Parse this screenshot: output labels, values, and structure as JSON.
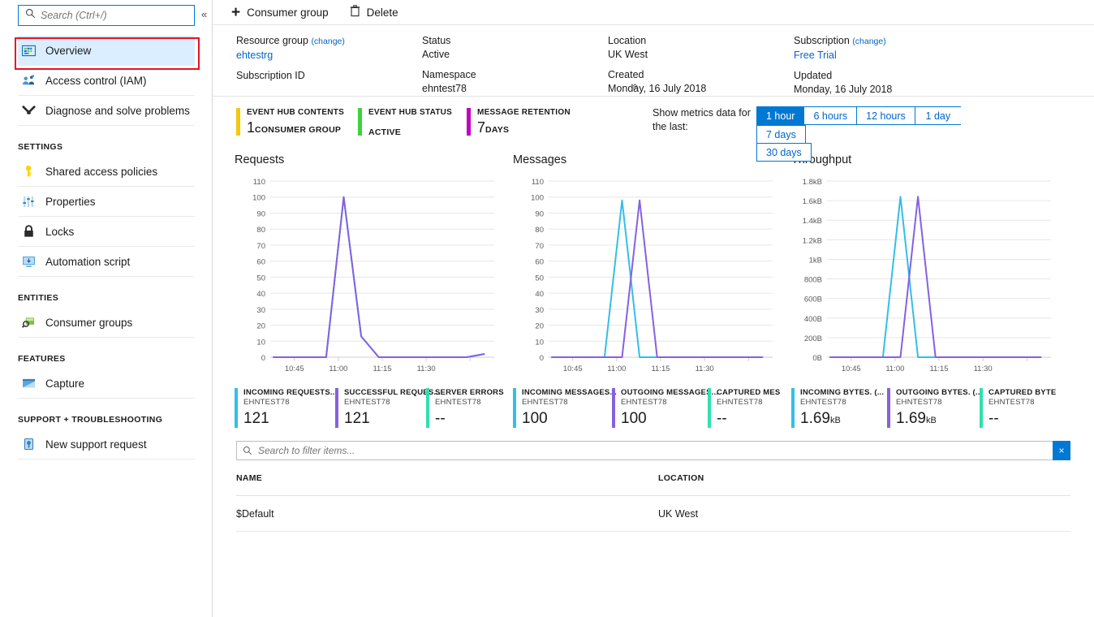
{
  "sidebar": {
    "search": {
      "placeholder": "Search (Ctrl+/)",
      "value": ""
    },
    "collapse_label": "«",
    "items": [
      {
        "label": "Overview",
        "icon": "overview-icon",
        "selected": true
      },
      {
        "label": "Access control (IAM)",
        "icon": "access-control-icon",
        "selected": false
      },
      {
        "label": "Diagnose and solve problems",
        "icon": "diagnose-icon",
        "selected": false
      }
    ],
    "groups": [
      {
        "title": "SETTINGS",
        "items": [
          {
            "label": "Shared access policies",
            "icon": "key-icon"
          },
          {
            "label": "Properties",
            "icon": "sliders-icon"
          },
          {
            "label": "Locks",
            "icon": "lock-icon"
          },
          {
            "label": "Automation script",
            "icon": "automation-script-icon"
          }
        ]
      },
      {
        "title": "ENTITIES",
        "items": [
          {
            "label": "Consumer groups",
            "icon": "consumer-groups-icon"
          }
        ]
      },
      {
        "title": "FEATURES",
        "items": [
          {
            "label": "Capture",
            "icon": "capture-icon"
          }
        ]
      },
      {
        "title": "SUPPORT + TROUBLESHOOTING",
        "items": [
          {
            "label": "New support request",
            "icon": "support-request-icon"
          }
        ]
      }
    ]
  },
  "toolbar": {
    "add_consumer_group": "Consumer group",
    "delete": "Delete"
  },
  "resource_info": {
    "collapse_label": "«",
    "columns": [
      [
        {
          "label": "Resource group",
          "change": "(change)",
          "value": "ehtestrg",
          "value_is_link": true
        },
        {
          "label": "Subscription ID",
          "value": ""
        }
      ],
      [
        {
          "label": "Status",
          "value": "Active"
        },
        {
          "label": "Namespace",
          "value": "ehntest78"
        }
      ],
      [
        {
          "label": "Location",
          "value": "UK West"
        },
        {
          "label": "Created",
          "value": "Monday, 16 July 2018"
        }
      ],
      [
        {
          "label": "Subscription",
          "change": "(change)",
          "value": "Free Trial",
          "value_is_link": true
        },
        {
          "label": "Updated",
          "value": "Monday, 16 July 2018"
        }
      ]
    ]
  },
  "status_tiles": [
    {
      "title": "EVENT HUB CONTENTS",
      "big": "1",
      "small": "CONSUMER GROUP",
      "color": "#f2c811"
    },
    {
      "title": "EVENT HUB STATUS",
      "big": "",
      "small": "ACTIVE",
      "color": "#3ad43a"
    },
    {
      "title": "MESSAGE RETENTION",
      "big": "7",
      "small": "DAYS",
      "color": "#c000c0"
    }
  ],
  "metric_picker": {
    "label": "Show metrics data for the last:",
    "options": [
      "1 hour",
      "6 hours",
      "12 hours",
      "1 day",
      "7 days",
      "30 days"
    ],
    "selected": "1 hour",
    "accent": "#0078d4"
  },
  "chart_data": [
    {
      "type": "line",
      "title": "Requests",
      "xlabel": "",
      "ylabel": "",
      "ylim": [
        0,
        110
      ],
      "yticks": [
        0,
        10,
        20,
        30,
        40,
        50,
        60,
        70,
        80,
        90,
        100,
        110
      ],
      "ytick_labels": [
        "0",
        "10",
        "20",
        "30",
        "40",
        "50",
        "60",
        "70",
        "80",
        "90",
        "100",
        "110"
      ],
      "xticks": [
        "10:45",
        "11:00",
        "11:15",
        "11:30"
      ],
      "grid": true,
      "legend_position": "below",
      "series": [
        {
          "name": "INCOMING REQUESTS...",
          "color": "#33bfe8",
          "x": [
            0,
            1,
            2,
            3,
            4,
            5,
            6,
            7,
            8,
            9,
            10,
            11,
            12
          ],
          "values": [
            0,
            0,
            0,
            0,
            100,
            13,
            0,
            0,
            0,
            0,
            0,
            0,
            2
          ]
        },
        {
          "name": "SUCCESSFUL REQUES...",
          "color": "#8661e0",
          "x": [
            0,
            1,
            2,
            3,
            4,
            5,
            6,
            7,
            8,
            9,
            10,
            11,
            12
          ],
          "values": [
            0,
            0,
            0,
            0,
            100,
            13,
            0,
            0,
            0,
            0,
            0,
            0,
            2
          ]
        },
        {
          "name": "SERVER ERRORS",
          "color": "#2fe0b0",
          "x": [],
          "values": []
        }
      ],
      "legend": [
        {
          "name": "INCOMING REQUESTS...",
          "sub": "EHNTEST78",
          "value": "121",
          "unit": "",
          "color": "#33bfe8"
        },
        {
          "name": "SUCCESSFUL REQUES...",
          "sub": "EHNTEST78",
          "value": "121",
          "unit": "",
          "color": "#8661e0"
        },
        {
          "name": "SERVER ERRORS",
          "sub": "EHNTEST78",
          "value": "--",
          "unit": "",
          "color": "#2fe0b0"
        }
      ]
    },
    {
      "type": "line",
      "title": "Messages",
      "xlabel": "",
      "ylabel": "",
      "ylim": [
        0,
        110
      ],
      "yticks": [
        0,
        10,
        20,
        30,
        40,
        50,
        60,
        70,
        80,
        90,
        100,
        110
      ],
      "ytick_labels": [
        "0",
        "10",
        "20",
        "30",
        "40",
        "50",
        "60",
        "70",
        "80",
        "90",
        "100",
        "110"
      ],
      "xticks": [
        "10:45",
        "11:00",
        "11:15",
        "11:30"
      ],
      "grid": true,
      "legend_position": "below",
      "series": [
        {
          "name": "INCOMING MESSAGES...",
          "color": "#33bfe8",
          "x": [
            0,
            1,
            2,
            3,
            4,
            5,
            6,
            7,
            8,
            9,
            10,
            11,
            12
          ],
          "values": [
            0,
            0,
            0,
            0,
            98,
            0,
            0,
            0,
            0,
            0,
            0,
            0,
            0
          ]
        },
        {
          "name": "OUTGOING MESSAGES...",
          "color": "#8661e0",
          "x": [
            0,
            1,
            2,
            3,
            4,
            5,
            6,
            7,
            8,
            9,
            10,
            11,
            12
          ],
          "values": [
            0,
            0,
            0,
            0,
            0,
            98,
            0,
            0,
            0,
            0,
            0,
            0,
            0
          ]
        },
        {
          "name": "CAPTURED MES",
          "color": "#2fe0b0",
          "x": [],
          "values": []
        }
      ],
      "legend": [
        {
          "name": "INCOMING MESSAGES...",
          "sub": "EHNTEST78",
          "value": "100",
          "unit": "",
          "color": "#33bfe8"
        },
        {
          "name": "OUTGOING MESSAGES...",
          "sub": "EHNTEST78",
          "value": "100",
          "unit": "",
          "color": "#8661e0"
        },
        {
          "name": "CAPTURED MES",
          "sub": "EHNTEST78",
          "value": "--",
          "unit": "",
          "color": "#2fe0b0"
        }
      ]
    },
    {
      "type": "line",
      "title": "Throughput",
      "xlabel": "",
      "ylabel": "",
      "ylim": [
        0,
        1800
      ],
      "yticks": [
        0,
        200,
        400,
        600,
        800,
        1000,
        1200,
        1400,
        1600,
        1800
      ],
      "ytick_labels": [
        "0B",
        "200B",
        "400B",
        "600B",
        "800B",
        "1kB",
        "1.2kB",
        "1.4kB",
        "1.6kB",
        "1.8kB"
      ],
      "xticks": [
        "10:45",
        "11:00",
        "11:15",
        "11:30"
      ],
      "grid": true,
      "legend_position": "below",
      "series": [
        {
          "name": "INCOMING BYTES. (...",
          "color": "#33bfe8",
          "x": [
            0,
            1,
            2,
            3,
            4,
            5,
            6,
            7,
            8,
            9,
            10,
            11,
            12
          ],
          "values": [
            0,
            0,
            0,
            0,
            1640,
            0,
            0,
            0,
            0,
            0,
            0,
            0,
            0
          ]
        },
        {
          "name": "OUTGOING BYTES. (...",
          "color": "#8661e0",
          "x": [
            0,
            1,
            2,
            3,
            4,
            5,
            6,
            7,
            8,
            9,
            10,
            11,
            12
          ],
          "values": [
            0,
            0,
            0,
            0,
            0,
            1640,
            0,
            0,
            0,
            0,
            0,
            0,
            0
          ]
        },
        {
          "name": "CAPTURED BYTE",
          "color": "#2fe0b0",
          "x": [],
          "values": []
        }
      ],
      "legend": [
        {
          "name": "INCOMING BYTES. (...",
          "sub": "EHNTEST78",
          "value": "1.69",
          "unit": "kB",
          "color": "#33bfe8"
        },
        {
          "name": "OUTGOING BYTES. (...",
          "sub": "EHNTEST78",
          "value": "1.69",
          "unit": "kB",
          "color": "#8661e0"
        },
        {
          "name": "CAPTURED BYTE",
          "sub": "EHNTEST78",
          "value": "--",
          "unit": "",
          "color": "#2fe0b0"
        }
      ]
    }
  ],
  "filter": {
    "placeholder": "Search to filter items...",
    "value": "",
    "clear_label": "×"
  },
  "table": {
    "headers": [
      "NAME",
      "LOCATION"
    ],
    "rows": [
      {
        "name": "$Default",
        "location": "UK West"
      }
    ]
  }
}
